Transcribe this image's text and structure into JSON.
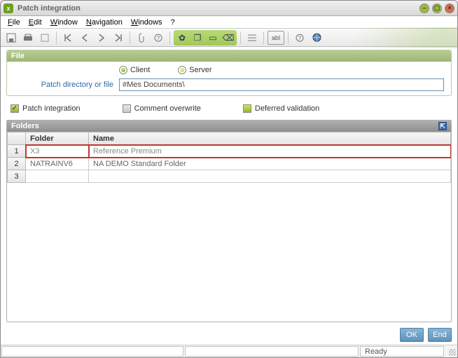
{
  "window": {
    "title": "Patch integration"
  },
  "menu": {
    "file": "File",
    "edit": "Edit",
    "window": "Window",
    "navigation": "Navigation",
    "windows": "Windows",
    "help": "?"
  },
  "file_panel": {
    "title": "File",
    "client_label": "Client",
    "server_label": "Server",
    "selected": "client",
    "path_label": "Patch directory or file",
    "path_value": "#Mes Documents\\"
  },
  "checks": {
    "patch_integration": "Patch integration",
    "comment_overwrite": "Comment overwrite",
    "deferred_validation": "Deferred validation"
  },
  "folders_panel": {
    "title": "Folders",
    "col_folder": "Folder",
    "col_name": "Name",
    "rows": [
      {
        "n": "1",
        "folder": "X3",
        "name": "Reference Premium"
      },
      {
        "n": "2",
        "folder": "NATRAINV6",
        "name": "NA DEMO Standard Folder"
      },
      {
        "n": "3",
        "folder": "",
        "name": ""
      }
    ]
  },
  "buttons": {
    "ok": "OK",
    "end": "End"
  },
  "status": {
    "ready": "Ready"
  }
}
